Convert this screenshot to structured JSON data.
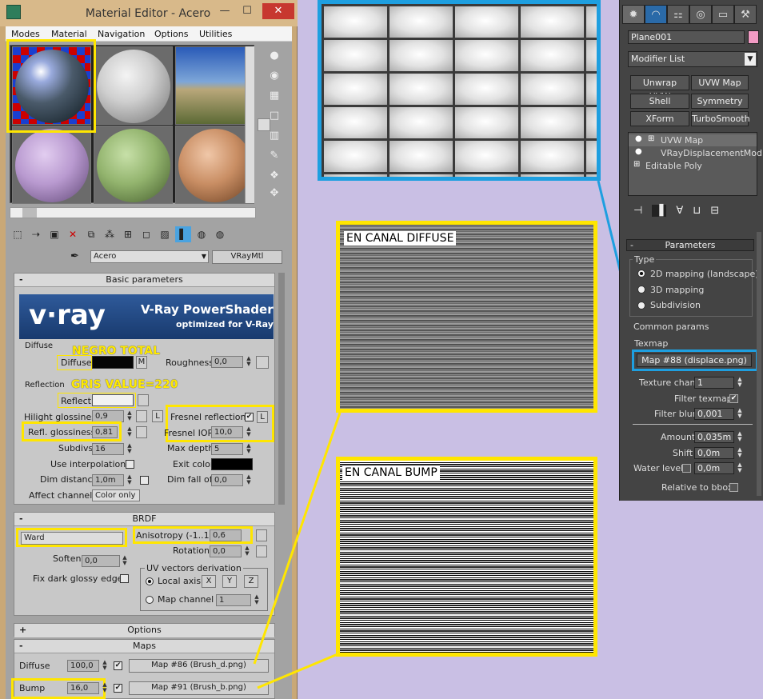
{
  "window": {
    "title": "Material Editor - Acero",
    "min": "—",
    "max": "☐",
    "close": "✕"
  },
  "menu": [
    "Modes",
    "Material",
    "Navigation",
    "Options",
    "Utilities"
  ],
  "material": {
    "name": "Acero",
    "type": "VRayMtl"
  },
  "rollouts": {
    "basic": "Basic parameters",
    "brdf": "BRDF",
    "options": "Options",
    "maps": "Maps",
    "minus": "-",
    "plus": "+"
  },
  "vray": {
    "logo": "v·ray",
    "product": "V-Ray PowerShader",
    "tagline": "optimized for V-Ray"
  },
  "diffuse": {
    "group": "Diffuse",
    "label": "Diffuse",
    "m_btn": "M",
    "roughness_label": "Roughness",
    "roughness": "0,0",
    "color": "#050505"
  },
  "reflection": {
    "group": "Reflection",
    "reflect_label": "Reflect",
    "reflect_color": "#f2f2f2",
    "hilight_label": "Hilight glossiness",
    "hilight": "0,9",
    "L": "L",
    "refl_gloss_label": "Refl. glossiness",
    "refl_gloss": "0,81",
    "fresnel_label": "Fresnel reflections",
    "fresnel_checked": "✔",
    "fresnel_ior_label": "Fresnel IOR",
    "fresnel_ior": "10,0",
    "subdivs_label": "Subdivs",
    "subdivs": "16",
    "max_depth_label": "Max depth",
    "max_depth": "5",
    "use_interp_label": "Use interpolation",
    "exit_color_label": "Exit color",
    "dim_dist_label": "Dim distance",
    "dim_dist": "1,0m",
    "dim_fall_label": "Dim fall off",
    "dim_fall": "0,0",
    "affect_label": "Affect channels",
    "affect_value": "Color only"
  },
  "brdf": {
    "type": "Ward",
    "anisotropy_label": "Anisotropy (-1..1)",
    "anisotropy": "0,6",
    "rotation_label": "Rotation",
    "rotation": "0,0",
    "soften_label": "Soften",
    "soften": "0,0",
    "fix_dark_label": "Fix dark glossy edges",
    "uv_group": "UV vectors derivation",
    "local_axis_label": "Local axis",
    "x": "X",
    "y": "Y",
    "z": "Z",
    "map_channel_label": "Map channel",
    "map_channel": "1"
  },
  "maps": {
    "diffuse_label": "Diffuse",
    "diffuse_amount": "100,0",
    "diffuse_map": "Map #86 (Brush_d.png)",
    "bump_label": "Bump",
    "bump_amount": "16,0",
    "bump_map": "Map #91 (Brush_b.png)",
    "check": "✔"
  },
  "annotations": {
    "negro": "NEGRO TOTAL",
    "gris": "GRIS VALUE=220",
    "en_diffuse": "EN CANAL DIFFUSE",
    "en_bump": "EN CANAL BUMP"
  },
  "cmdpanel": {
    "object_name": "Plane001",
    "object_color": "#f29bc4",
    "modifier_list": "Modifier List",
    "buttons": [
      "Unwrap UVW",
      "UVW Map",
      "Shell",
      "Symmetry",
      "XForm",
      "TurboSmooth"
    ],
    "stack": [
      "UVW Map",
      "VRayDisplacementMod",
      "Editable Poly"
    ],
    "parameters": "Parameters",
    "type_group": "Type",
    "type_options": [
      "2D mapping (landscape)",
      "3D mapping",
      "Subdivision"
    ],
    "common_params": "Common params",
    "texmap_label": "Texmap",
    "texmap": "Map #88 (displace.png)",
    "texture_chan_label": "Texture chan",
    "texture_chan": "1",
    "filter_texmap_label": "Filter texmap",
    "filter_blur_label": "Filter blur",
    "filter_blur": "0,001",
    "amount_label": "Amount",
    "amount": "0,035m",
    "shift_label": "Shift",
    "shift": "0,0m",
    "water_label": "Water level",
    "water": "0,0m",
    "relative_label": "Relative to bbox"
  }
}
